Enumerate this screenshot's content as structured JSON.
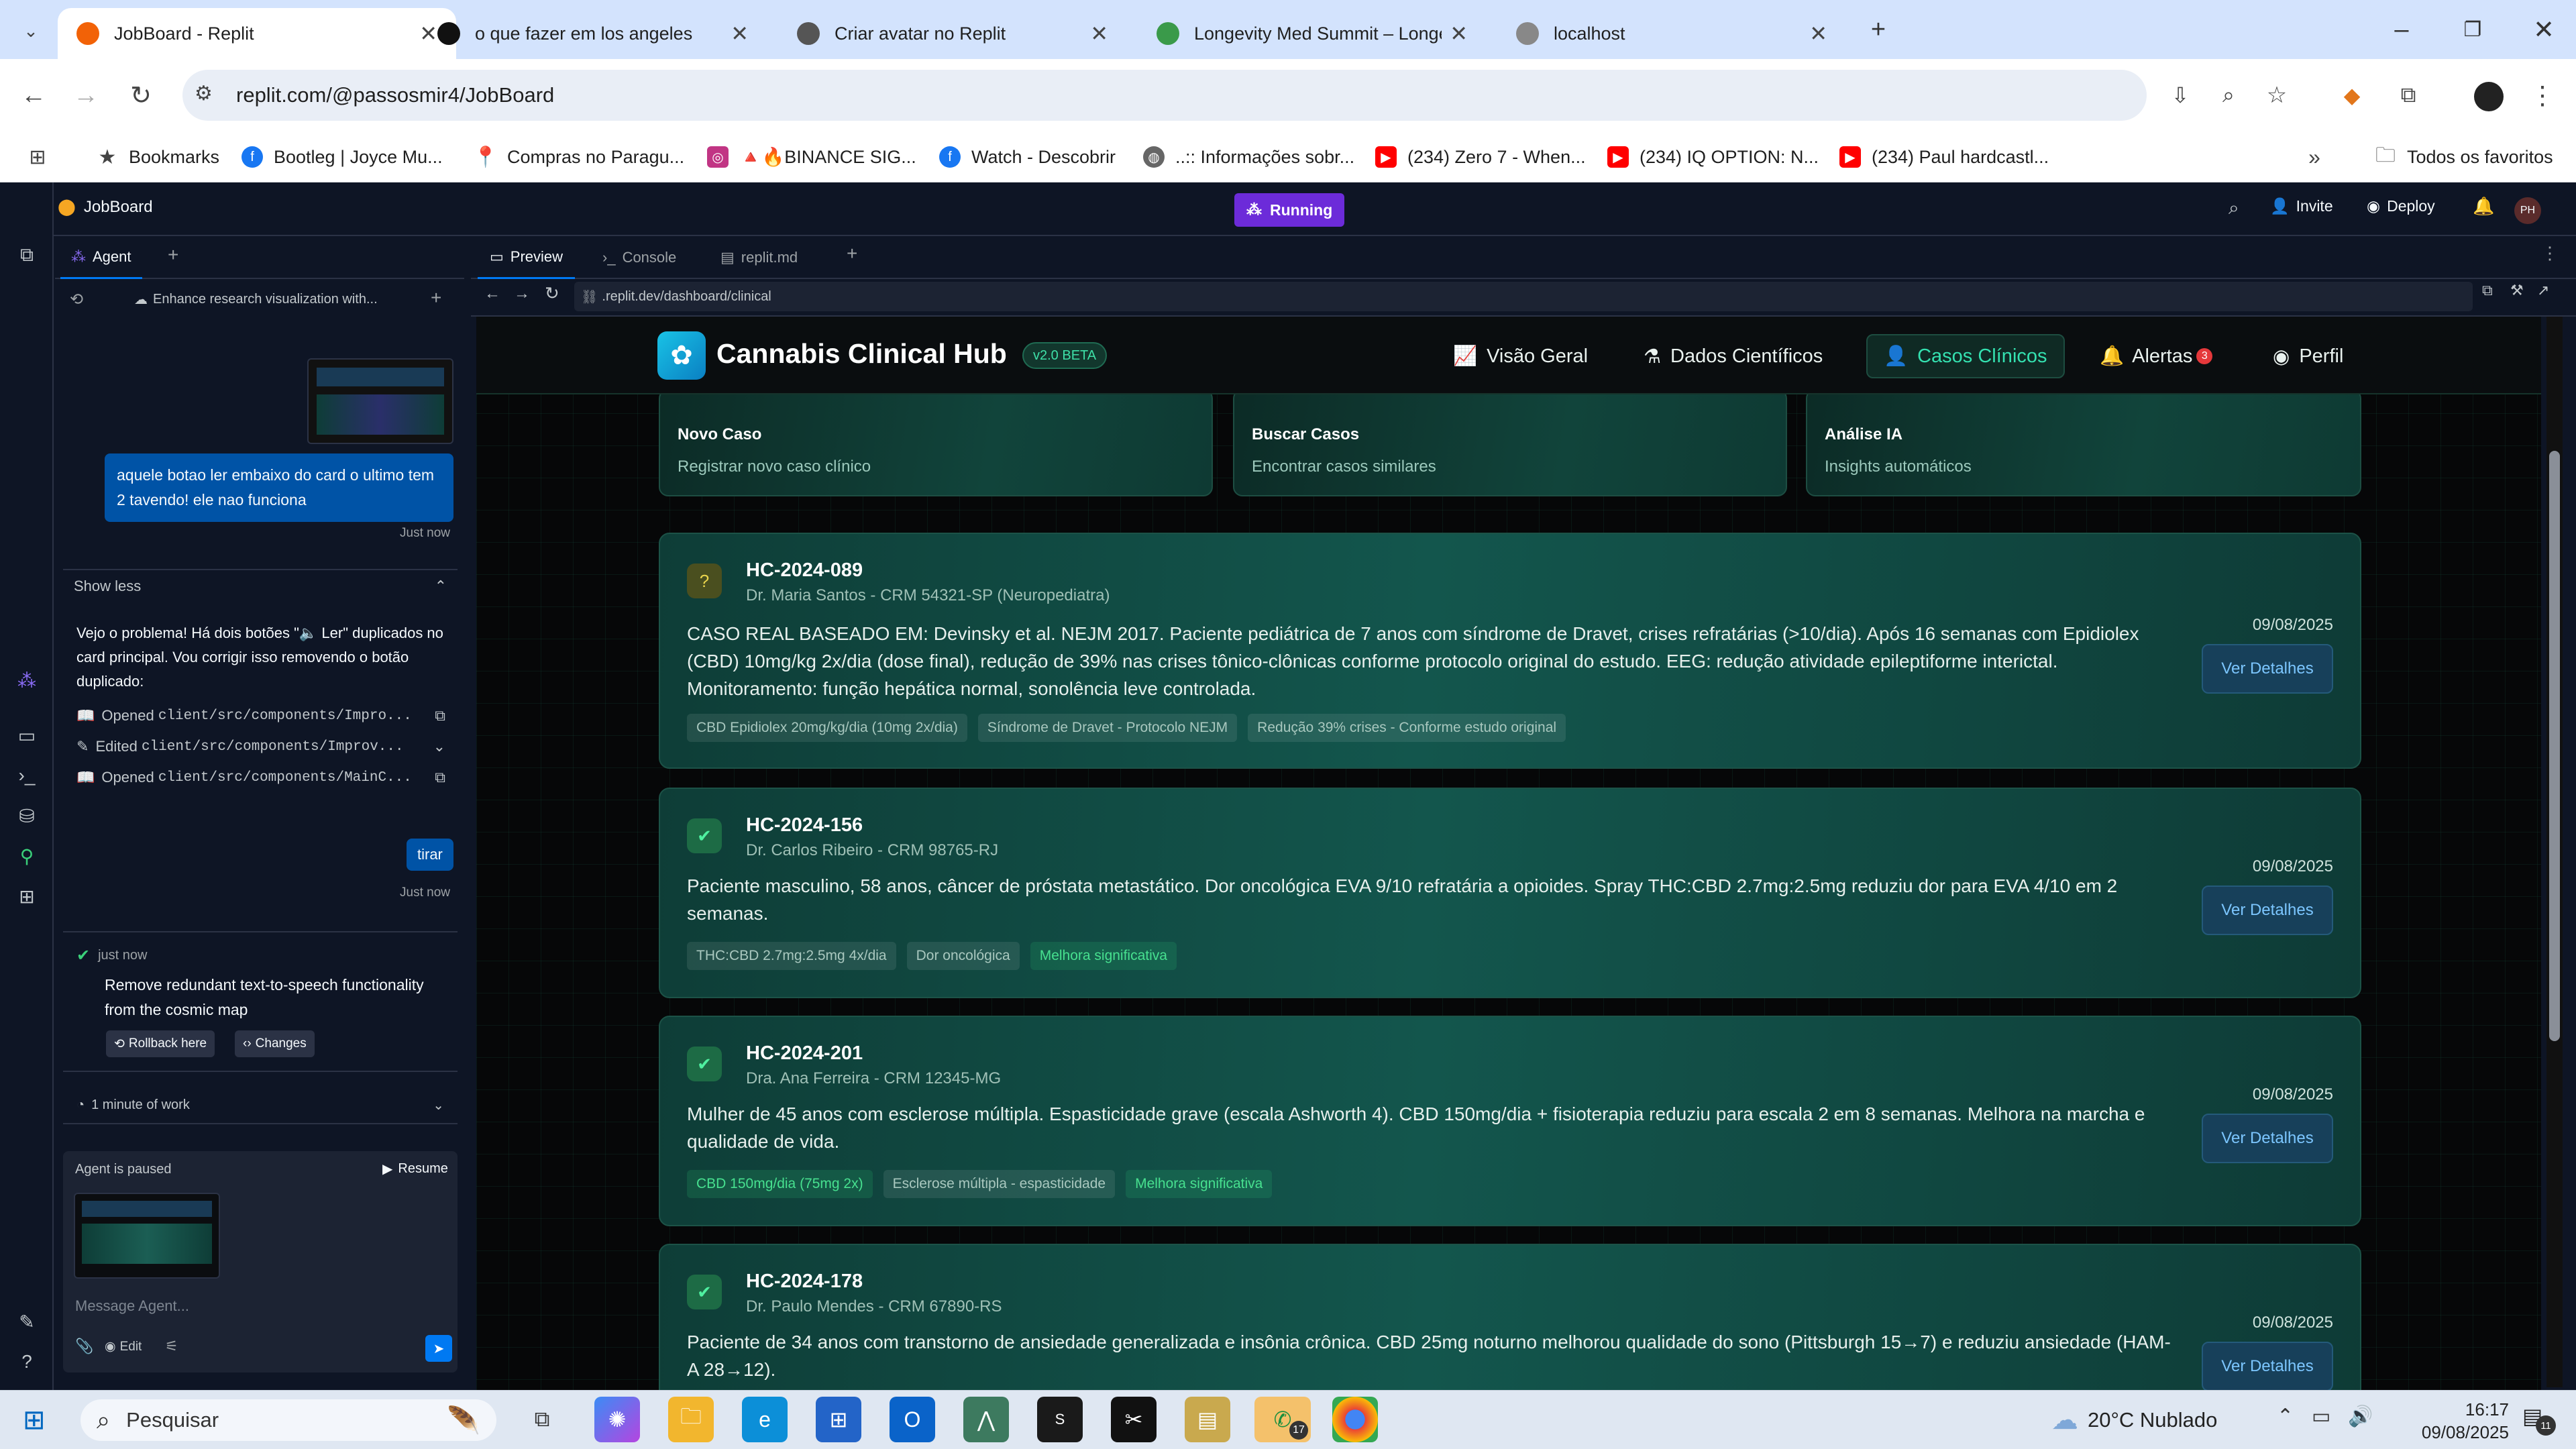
{
  "browser": {
    "tabs": [
      {
        "title": "JobBoard - Replit",
        "color": "#f26207"
      },
      {
        "title": "o que fazer em los angeles",
        "color": "#111111"
      },
      {
        "title": "Criar avatar no Replit",
        "color": "#555555"
      },
      {
        "title": "Longevity Med Summit – Longe",
        "color": "#3a9a4a"
      },
      {
        "title": "localhost",
        "color": "#888888"
      }
    ],
    "url": "replit.com/@passosmir4/JobBoard",
    "bookmarks": [
      {
        "label": "Bookmarks",
        "icon": "star-icon"
      },
      {
        "label": "Bootleg | Joyce Mu...",
        "icon": "facebook-icon"
      },
      {
        "label": "Compras no Paragu...",
        "icon": "pin-icon"
      },
      {
        "label": "🔺🔥BINANCE SIG...",
        "icon": "instagram-icon"
      },
      {
        "label": "Watch - Descobrir",
        "icon": "facebook-icon"
      },
      {
        "label": "..:: Informações sobr...",
        "icon": "globe-icon"
      },
      {
        "label": "(234) Zero 7 - When...",
        "icon": "youtube-icon"
      },
      {
        "label": "(234) IQ OPTION: N...",
        "icon": "youtube-icon"
      },
      {
        "label": "(234) Paul hardcastl...",
        "icon": "youtube-icon"
      }
    ],
    "all_bookmarks": "Todos os favoritos"
  },
  "replit": {
    "project": "JobBoard",
    "status": "Running",
    "invite": "Invite",
    "deploy": "Deploy",
    "avatar": "PH",
    "agent_tab": "Agent",
    "thread_title": "Enhance research visualization with...",
    "user_msg_1": "aquele botao ler embaixo do card o ultimo tem 2 tavendo! ele nao funciona",
    "just_now_1": "Just now",
    "show_less": "Show less",
    "agent_reply": "Vejo o problema! Há dois botões \"🔈 Ler\" duplicados no card principal. Vou corrigir isso removendo o botão duplicado:",
    "file_actions": [
      {
        "verb": "Opened",
        "path": "client/src/components/Impro..."
      },
      {
        "verb": "Edited",
        "path": "client/src/components/Improv..."
      },
      {
        "verb": "Opened",
        "path": "client/src/components/MainC..."
      }
    ],
    "user_msg_2": "tirar",
    "just_now_2": "Just now",
    "checkpoint_time": "just now",
    "checkpoint_text": "Remove redundant text-to-speech functionality from the cosmic map",
    "rollback": "Rollback here",
    "changes": "Changes",
    "work_time": "1 minute of work",
    "paused": "Agent is paused",
    "resume": "Resume",
    "message_placeholder": "Message Agent...",
    "edit": "Edit",
    "pane_tabs": [
      "Preview",
      "Console",
      "replit.md"
    ],
    "preview_url": ".replit.dev/dashboard/clinical"
  },
  "app": {
    "title": "Cannabis Clinical Hub",
    "version": "v2.0 BETA",
    "nav": [
      {
        "label": "Visão Geral",
        "icon": "chart-icon"
      },
      {
        "label": "Dados Científicos",
        "icon": "flask-icon"
      },
      {
        "label": "Casos Clínicos",
        "icon": "user-icon",
        "active": true
      },
      {
        "label": "Alertas",
        "icon": "bell-icon",
        "badge": "3"
      },
      {
        "label": "Perfil",
        "icon": "profile-icon"
      }
    ],
    "actions": [
      {
        "title": "Novo Caso",
        "subtitle": "Registrar novo caso clínico"
      },
      {
        "title": "Buscar Casos",
        "subtitle": "Encontrar casos similares"
      },
      {
        "title": "Análise IA",
        "subtitle": "Insights automáticos"
      }
    ],
    "button_label": "Ver Detalhes",
    "cases": [
      {
        "id": "HC-2024-089",
        "doctor": "Dr. Maria Santos - CRM 54321-SP (Neuropediatra)",
        "description": "CASO REAL BASEADO EM: Devinsky et al. NEJM 2017. Paciente pediátrica de 7 anos com síndrome de Dravet, crises refratárias (>10/dia). Após 16 semanas com Epidiolex (CBD) 10mg/kg 2x/dia (dose final), redução de 39% nas crises tônico-clônicas conforme protocolo original do estudo. EEG: redução atividade epileptiforme interictal. Monitoramento: função hepática normal, sonolência leve controlada.",
        "date": "09/08/2025",
        "status": "pending",
        "tags": [
          {
            "text": "CBD Epidiolex 20mg/kg/dia (10mg 2x/dia)",
            "green": false
          },
          {
            "text": "Síndrome de Dravet - Protocolo NEJM",
            "green": false
          },
          {
            "text": "Redução 39% crises - Conforme estudo original",
            "green": false
          }
        ]
      },
      {
        "id": "HC-2024-156",
        "doctor": "Dr. Carlos Ribeiro - CRM 98765-RJ",
        "description": "Paciente masculino, 58 anos, câncer de próstata metastático. Dor oncológica EVA 9/10 refratária a opioides. Spray THC:CBD 2.7mg:2.5mg reduziu dor para EVA 4/10 em 2 semanas.",
        "date": "09/08/2025",
        "status": "done",
        "tags": [
          {
            "text": "THC:CBD 2.7mg:2.5mg 4x/dia",
            "green": false
          },
          {
            "text": "Dor oncológica",
            "green": false
          },
          {
            "text": "Melhora significativa",
            "green": true
          }
        ]
      },
      {
        "id": "HC-2024-201",
        "doctor": "Dra. Ana Ferreira - CRM 12345-MG",
        "description": "Mulher de 45 anos com esclerose múltipla. Espasticidade grave (escala Ashworth 4). CBD 150mg/dia + fisioterapia reduziu para escala 2 em 8 semanas. Melhora na marcha e qualidade de vida.",
        "date": "09/08/2025",
        "status": "done",
        "tags": [
          {
            "text": "CBD 150mg/dia (75mg 2x)",
            "green": true
          },
          {
            "text": "Esclerose múltipla - espasticidade",
            "green": false
          },
          {
            "text": "Melhora significativa",
            "green": true
          }
        ]
      },
      {
        "id": "HC-2024-178",
        "doctor": "Dr. Paulo Mendes - CRM 67890-RS",
        "description": "Paciente de 34 anos com transtorno de ansiedade generalizada e insônia crônica. CBD 25mg noturno melhorou qualidade do sono (Pittsburgh 15→7) e reduziu ansiedade (HAM-A 28→12).",
        "date": "09/08/2025",
        "status": "done",
        "tags": []
      }
    ]
  },
  "taskbar": {
    "search": "Pesquisar",
    "weather": "20°C  Nublado",
    "time": "16:17",
    "date": "09/08/2025",
    "whatsapp_badge": "17",
    "notif_badge": "11"
  }
}
